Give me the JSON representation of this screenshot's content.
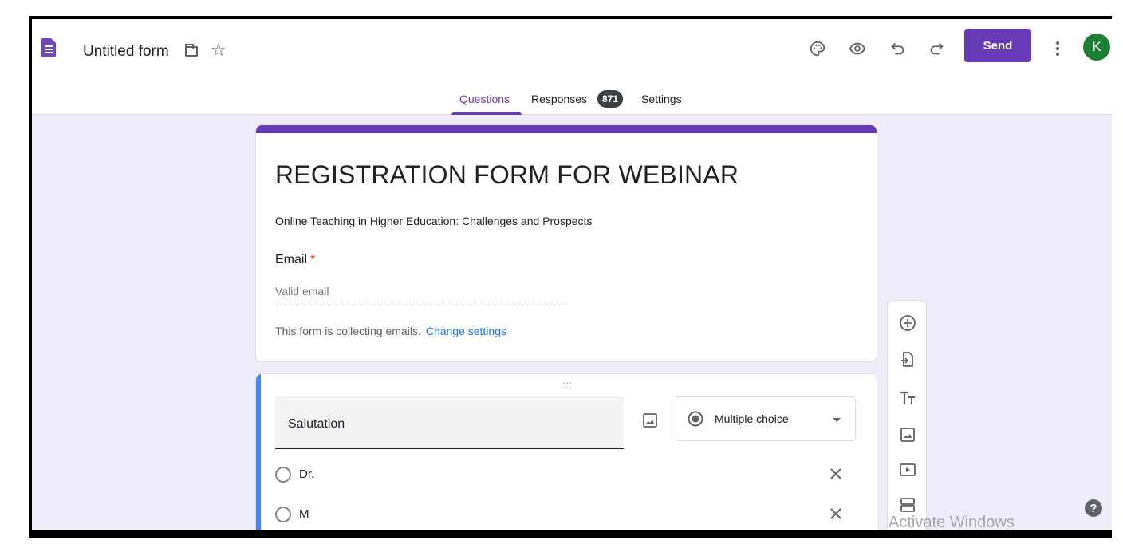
{
  "header": {
    "title": "Untitled form",
    "send_label": "Send",
    "avatar_initial": "K"
  },
  "tabs": {
    "questions": "Questions",
    "responses": "Responses",
    "responses_count": "871",
    "settings": "Settings"
  },
  "form": {
    "title": "REGISTRATION FORM FOR WEBINAR",
    "description": "Online Teaching in Higher Education: Challenges and Prospects",
    "email_label": "Email",
    "required_mark": "*",
    "email_placeholder": "Valid email",
    "collect_note": "This form is collecting emails.",
    "change_settings": "Change settings"
  },
  "question": {
    "text": "Salutation",
    "type": "Multiple choice",
    "options": [
      "Dr.",
      "M"
    ]
  },
  "overlay": {
    "watermark": "Activate Windows"
  },
  "colors": {
    "accent": "#673ab7",
    "background": "#f0ebf8",
    "question_accent": "#4285f4",
    "avatar": "#1e7e34"
  },
  "icons": {
    "toolbar": [
      "palette-icon",
      "preview-icon",
      "undo-icon",
      "redo-icon",
      "more-vert-icon"
    ],
    "side": [
      "add-question-icon",
      "import-questions-icon",
      "add-title-icon",
      "add-image-icon",
      "add-video-icon",
      "add-section-icon"
    ]
  }
}
